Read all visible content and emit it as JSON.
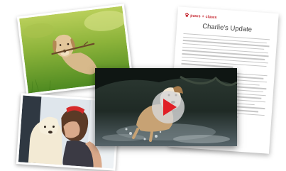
{
  "document": {
    "brand": "paws + claws",
    "brand_icon": "paw-icon",
    "title": "Charlie's Update",
    "brand_color": "#c62a33"
  },
  "video": {
    "play_icon": "play-icon",
    "play_color": "#e01f26"
  },
  "photos": [
    {
      "subject": "dog-with-stick-in-grass"
    },
    {
      "subject": "woman-kissing-dog"
    },
    {
      "subject": "dog-running-in-water"
    }
  ]
}
